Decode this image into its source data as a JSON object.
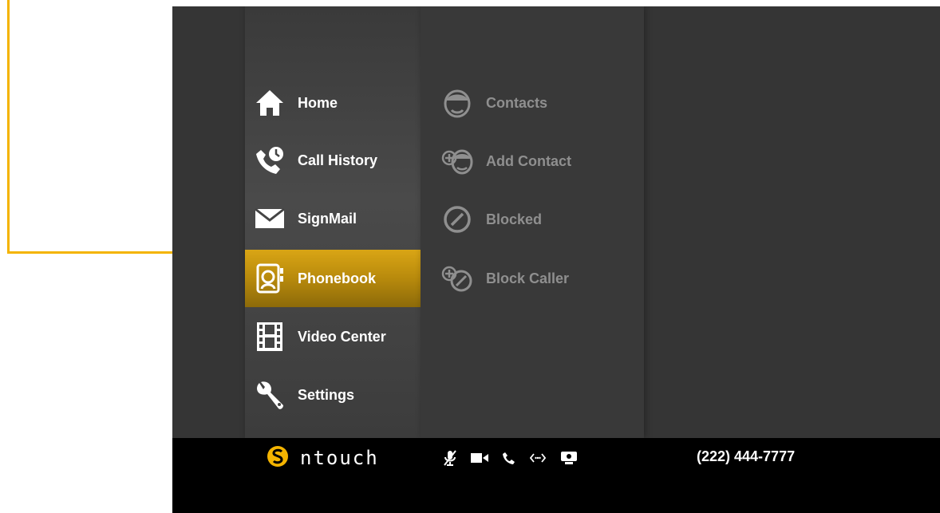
{
  "menu": {
    "items": [
      {
        "label": "Home",
        "icon": "home-icon"
      },
      {
        "label": "Call History",
        "icon": "call-history-icon"
      },
      {
        "label": "SignMail",
        "icon": "envelope-icon"
      },
      {
        "label": "Phonebook",
        "icon": "phonebook-icon",
        "selected": true
      },
      {
        "label": "Video Center",
        "icon": "film-icon"
      },
      {
        "label": "Settings",
        "icon": "wrench-icon"
      }
    ]
  },
  "submenu": {
    "items": [
      {
        "label": "Contacts",
        "icon": "contact-face-icon"
      },
      {
        "label": "Add Contact",
        "icon": "add-contact-icon"
      },
      {
        "label": "Blocked",
        "icon": "blocked-icon"
      },
      {
        "label": "Block Caller",
        "icon": "block-caller-icon"
      }
    ]
  },
  "status_bar": {
    "brand": "ntouch",
    "phone_number": "(222) 444-7777",
    "icons": [
      "mic-muted-icon",
      "video-camera-icon",
      "phone-icon",
      "network-icon",
      "display-icon"
    ]
  },
  "colors": {
    "accent": "#f4b400",
    "selected_item": "#c8990f",
    "background": "#353535",
    "status_bar": "#000000",
    "submenu_text": "#8f8f8f"
  }
}
